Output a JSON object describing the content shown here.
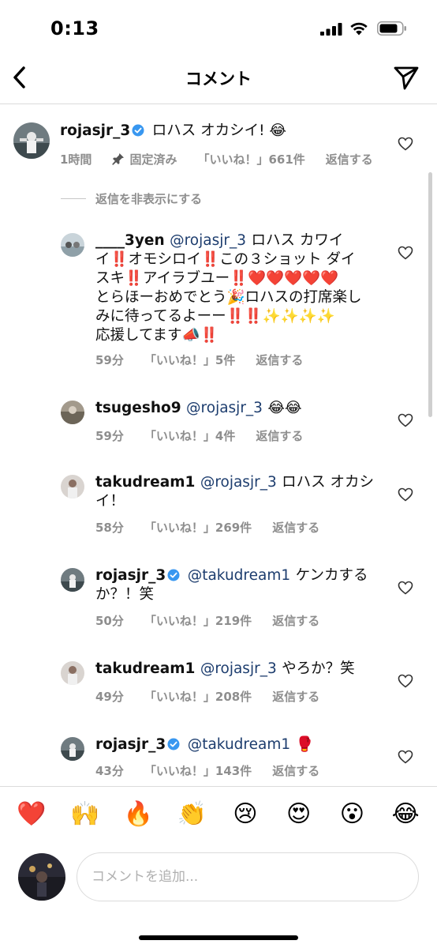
{
  "status_bar": {
    "time": "0:13"
  },
  "nav": {
    "title": "コメント"
  },
  "hide_replies": "返信を非表示にする",
  "main_comment": {
    "username": "rojasjr_3",
    "text": "ロハス オカシイ! 😂",
    "time": "1時間",
    "pinned": "固定済み",
    "likes": "「いいね！」661件",
    "reply": "返信する"
  },
  "replies": [
    {
      "username": "____3yen",
      "mention": "@rojasjr_3",
      "text_lines": [
        "ロハス カワイ",
        "イ‼️オモシロイ‼️この３ショット ダイ",
        "スキ‼️アイラブユー‼️❤️❤️❤️❤️❤️",
        "とらほーおめでとう🎉ロハスの打席楽し",
        "みに待ってるよーー‼️‼️✨✨✨✨",
        "応援してます📣‼️"
      ],
      "time": "59分",
      "likes": "「いいね！」5件",
      "reply": "返信する"
    },
    {
      "username": "tsugesho9",
      "mention": "@rojasjr_3",
      "text_lines": [
        "😂😂"
      ],
      "time": "59分",
      "likes": "「いいね！」4件",
      "reply": "返信する"
    },
    {
      "username": "takudream1",
      "mention": "@rojasjr_3",
      "text_lines": [
        "ロハス オカシ",
        "イ！"
      ],
      "time": "58分",
      "likes": "「いいね！」269件",
      "reply": "返信する"
    },
    {
      "username": "rojasjr_3",
      "mention": "@takudream1",
      "text_lines": [
        "ケンカする",
        "か？！笑"
      ],
      "time": "50分",
      "likes": "「いいね！」219件",
      "reply": "返信する"
    },
    {
      "username": "takudream1",
      "mention": "@rojasjr_3",
      "text_lines": [
        "やろか？笑"
      ],
      "time": "49分",
      "likes": "「いいね！」208件",
      "reply": "返信する"
    },
    {
      "username": "rojasjr_3",
      "mention": "@takudream1",
      "text_lines": [
        "🥊"
      ],
      "time": "43分",
      "likes": "「いいね！」143件",
      "reply": "返信する"
    }
  ],
  "emoji_bar": [
    "❤️",
    "🙌",
    "🔥",
    "👏",
    "😢",
    "😍",
    "😮",
    "😂"
  ],
  "input": {
    "placeholder": "コメントを追加..."
  },
  "colors": {
    "mention": "#1d3d6e",
    "meta": "#8e8e8e",
    "verified": "#3897f0"
  }
}
